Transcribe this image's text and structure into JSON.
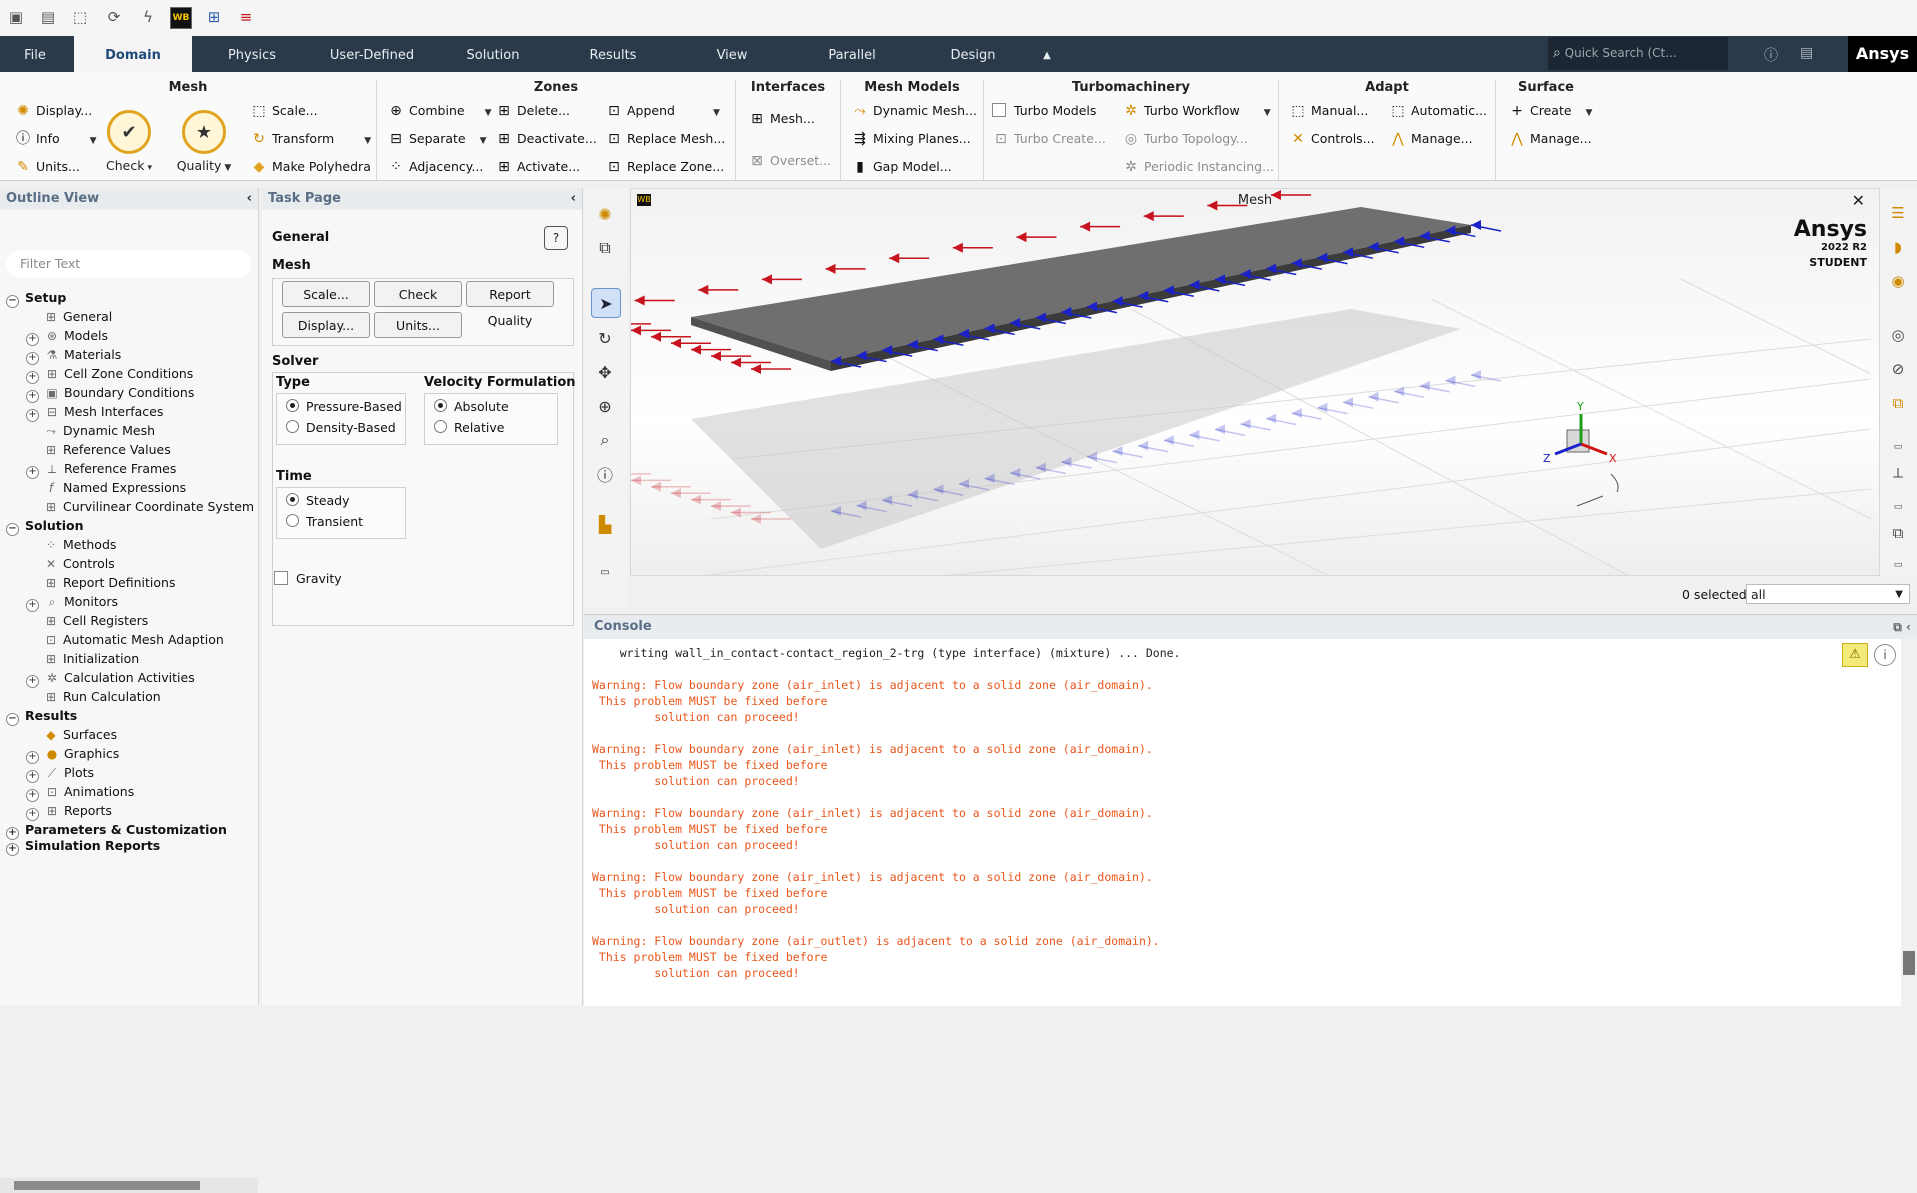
{
  "quickbar": {
    "icons": [
      "new-case-icon",
      "open-case-icon",
      "mesh-icon",
      "reload-icon",
      "run-icon",
      "workbench-icon",
      "parametric-icon",
      "report-icon"
    ],
    "wb_label": "WB"
  },
  "tabs": [
    "File",
    "Domain",
    "Physics",
    "User-Defined",
    "Solution",
    "Results",
    "View",
    "Parallel",
    "Design"
  ],
  "search": {
    "placeholder": "Quick Search (Ct..."
  },
  "brand": "Ansys",
  "ribbon": {
    "mesh": {
      "title": "Mesh",
      "display": "Display...",
      "info": "Info",
      "units": "Units...",
      "check": "Check",
      "quality": "Quality",
      "scale": "Scale...",
      "transform": "Transform",
      "make_polyhedra": "Make Polyhedra"
    },
    "zones": {
      "title": "Zones",
      "combine": "Combine",
      "separate": "Separate",
      "adjacency": "Adjacency...",
      "delete": "Delete...",
      "deactivate": "Deactivate...",
      "activate": "Activate...",
      "append": "Append",
      "replace_mesh": "Replace Mesh...",
      "replace_zone": "Replace Zone..."
    },
    "interfaces": {
      "title": "Interfaces",
      "mesh": "Mesh...",
      "overset": "Overset..."
    },
    "mesh_models": {
      "title": "Mesh Models",
      "dynamic_mesh": "Dynamic Mesh...",
      "mixing_planes": "Mixing Planes...",
      "gap_model": "Gap Model..."
    },
    "turbo": {
      "title": "Turbomachinery",
      "turbo_models": "Turbo Models",
      "turbo_create": "Turbo Create...",
      "turbo_workflow": "Turbo Workflow",
      "turbo_topology": "Turbo Topology...",
      "periodic_instancing": "Periodic Instancing..."
    },
    "adapt": {
      "title": "Adapt",
      "manual": "Manual...",
      "controls": "Controls...",
      "automatic": "Automatic...",
      "manage": "Manage..."
    },
    "surface": {
      "title": "Surface",
      "create": "Create",
      "manage": "Manage..."
    }
  },
  "outline": {
    "title": "Outline View",
    "filter_placeholder": "Filter Text",
    "items": [
      {
        "label": "Setup",
        "section": true
      },
      {
        "label": "General"
      },
      {
        "label": "Models"
      },
      {
        "label": "Materials"
      },
      {
        "label": "Cell Zone Conditions"
      },
      {
        "label": "Boundary Conditions"
      },
      {
        "label": "Mesh Interfaces"
      },
      {
        "label": "Dynamic Mesh"
      },
      {
        "label": "Reference Values"
      },
      {
        "label": "Reference Frames"
      },
      {
        "label": "Named Expressions"
      },
      {
        "label": "Curvilinear Coordinate System"
      },
      {
        "label": "Solution",
        "section": true
      },
      {
        "label": "Methods"
      },
      {
        "label": "Controls"
      },
      {
        "label": "Report Definitions"
      },
      {
        "label": "Monitors"
      },
      {
        "label": "Cell Registers"
      },
      {
        "label": "Automatic Mesh Adaption"
      },
      {
        "label": "Initialization"
      },
      {
        "label": "Calculation Activities"
      },
      {
        "label": "Run Calculation"
      },
      {
        "label": "Results",
        "section": true
      },
      {
        "label": "Surfaces"
      },
      {
        "label": "Graphics"
      },
      {
        "label": "Plots"
      },
      {
        "label": "Animations"
      },
      {
        "label": "Reports"
      },
      {
        "label": "Parameters & Customization",
        "section": true
      },
      {
        "label": "Simulation Reports",
        "section": true
      }
    ]
  },
  "task": {
    "title": "Task Page",
    "general": "General",
    "help": "?",
    "mesh_label": "Mesh",
    "buttons": {
      "scale": "Scale...",
      "check": "Check",
      "report_quality": "Report Quality",
      "display": "Display...",
      "units": "Units..."
    },
    "solver_label": "Solver",
    "type_label": "Type",
    "type_options": [
      "Pressure-Based",
      "Density-Based"
    ],
    "type_selected": "Pressure-Based",
    "velocity_label": "Velocity Formulation",
    "velocity_options": [
      "Absolute",
      "Relative"
    ],
    "velocity_selected": "Absolute",
    "time_label": "Time",
    "time_options": [
      "Steady",
      "Transient"
    ],
    "time_selected": "Steady",
    "gravity": "Gravity"
  },
  "viewport": {
    "title": "Mesh",
    "watermark_brand": "Ansys",
    "watermark_version": "2022 R2",
    "watermark_edition": "STUDENT",
    "triad": {
      "x": "X",
      "y": "Y",
      "z": "Z"
    }
  },
  "selection": {
    "count": "0 selected",
    "filter": "all"
  },
  "console": {
    "title": "Console",
    "lines": [
      {
        "kind": "norm",
        "text": "    writing wall_in_contact-contact_region_2-trg (type interface) (mixture) ... Done."
      },
      {
        "kind": "norm",
        "text": ""
      },
      {
        "kind": "warn",
        "text": "Warning: Flow boundary zone (air_inlet) is adjacent to a solid zone (air_domain)."
      },
      {
        "kind": "warn",
        "text": " This problem MUST be fixed before"
      },
      {
        "kind": "warn",
        "text": "         solution can proceed!"
      },
      {
        "kind": "norm",
        "text": ""
      },
      {
        "kind": "warn",
        "text": "Warning: Flow boundary zone (air_inlet) is adjacent to a solid zone (air_domain)."
      },
      {
        "kind": "warn",
        "text": " This problem MUST be fixed before"
      },
      {
        "kind": "warn",
        "text": "         solution can proceed!"
      },
      {
        "kind": "norm",
        "text": ""
      },
      {
        "kind": "warn",
        "text": "Warning: Flow boundary zone (air_inlet) is adjacent to a solid zone (air_domain)."
      },
      {
        "kind": "warn",
        "text": " This problem MUST be fixed before"
      },
      {
        "kind": "warn",
        "text": "         solution can proceed!"
      },
      {
        "kind": "norm",
        "text": ""
      },
      {
        "kind": "warn",
        "text": "Warning: Flow boundary zone (air_inlet) is adjacent to a solid zone (air_domain)."
      },
      {
        "kind": "warn",
        "text": " This problem MUST be fixed before"
      },
      {
        "kind": "warn",
        "text": "         solution can proceed!"
      },
      {
        "kind": "norm",
        "text": ""
      },
      {
        "kind": "warn",
        "text": "Warning: Flow boundary zone (air_outlet) is adjacent to a solid zone (air_domain)."
      },
      {
        "kind": "warn",
        "text": " This problem MUST be fixed before"
      },
      {
        "kind": "warn",
        "text": "         solution can proceed!"
      }
    ]
  },
  "colors": {
    "tabbar": "#2b3a4a",
    "inlet_arrows": "#c8141e",
    "outlet_arrows": "#1a22c8",
    "warning_text": "#e8561a",
    "panel_header": "#5a6e85"
  }
}
